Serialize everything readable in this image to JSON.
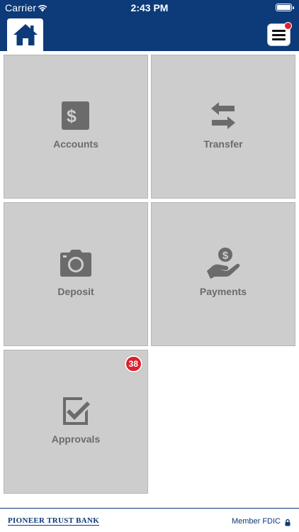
{
  "status_bar": {
    "carrier": "Carrier",
    "time": "2:43 PM"
  },
  "header": {
    "background": "#0d3a78",
    "home_icon": "home-icon",
    "menu_icon": "hamburger-menu-icon",
    "menu_notification_color": "#e2232f"
  },
  "tiles": [
    {
      "label": "Accounts",
      "icon": "dollar-bills-icon"
    },
    {
      "label": "Transfer",
      "icon": "transfer-arrows-icon"
    },
    {
      "label": "Deposit",
      "icon": "camera-icon"
    },
    {
      "label": "Payments",
      "icon": "hand-coin-icon"
    },
    {
      "label": "Approvals",
      "icon": "checkbox-icon",
      "badge": "38"
    }
  ],
  "colors": {
    "tile_background": "#cdcdcd",
    "tile_label": "#6b6b6b",
    "icon": "#6b6b6b",
    "badge": "#d9232d"
  },
  "footer": {
    "bank_name": "PIONEER TRUST BANK",
    "fdic": "Member FDIC",
    "lock_icon": "lock-icon"
  }
}
